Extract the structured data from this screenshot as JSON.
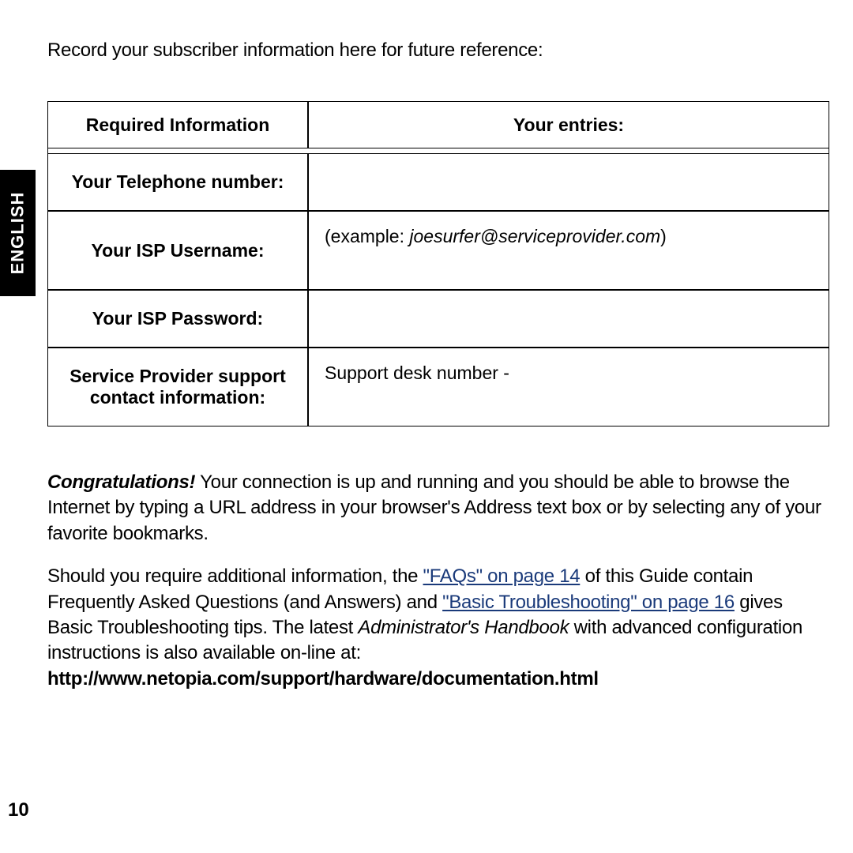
{
  "language_tab": "ENGLISH",
  "intro": "Record your subscriber information here for future reference:",
  "table": {
    "header_left": "Required Information",
    "header_right": "Your entries:",
    "rows": {
      "telephone": {
        "label": "Your Telephone number:",
        "entry": ""
      },
      "username": {
        "label": "Your ISP Username:",
        "entry_prefix": "(example: ",
        "entry_italic": "joesurfer@serviceprovider.com",
        "entry_suffix": ")"
      },
      "password": {
        "label": "Your ISP Password:",
        "entry": ""
      },
      "support": {
        "label": "Service Provider support contact information:",
        "entry": "Support desk number -"
      }
    }
  },
  "para1": {
    "congrats": "Congratulations!",
    "rest": " Your connection is up and running and you should be able to browse the Internet by typing a URL address in your browser's Address text box or by selecting any of your favorite bookmarks."
  },
  "para2": {
    "t1": "Should you require additional information, the ",
    "link1": "\"FAQs\" on page 14",
    "t2": " of this Guide contain Frequently Asked Questions (and Answers) and ",
    "link2": "\"Basic Troubleshooting\" on page 16",
    "t3": " gives Basic Troubleshooting tips. The latest ",
    "italic": "Administrator's Handbook",
    "t4": " with advanced configuration instructions is also available on-line at: ",
    "url": "http://www.netopia.com/support/hardware/documentation.html"
  },
  "page_number": "10"
}
